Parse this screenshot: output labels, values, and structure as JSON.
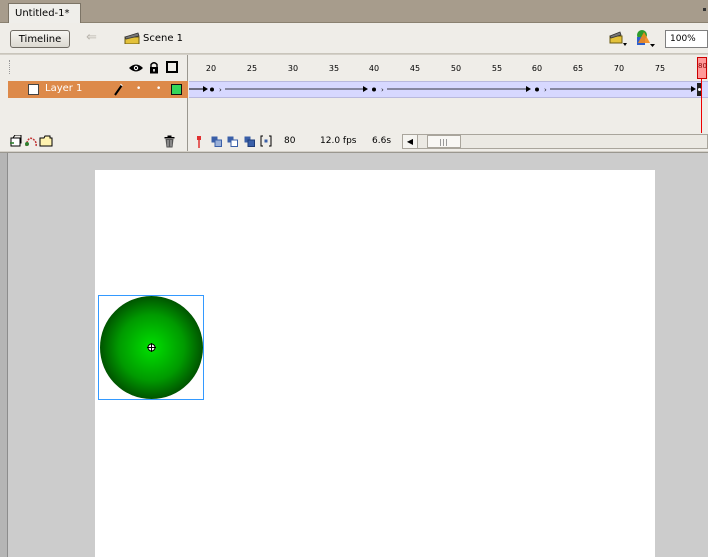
{
  "document": {
    "tab_title": "Untitled-1*"
  },
  "toolbar": {
    "timeline_label": "Timeline",
    "scene_label": "Scene 1",
    "zoom_value": "100%"
  },
  "timeline": {
    "layer_name": "Layer 1",
    "ruler_ticks": [
      "20",
      "25",
      "30",
      "35",
      "40",
      "45",
      "50",
      "55",
      "60",
      "65",
      "70",
      "75"
    ],
    "playhead_frame": "80",
    "current_frame": "80",
    "frame_rate": "12.0 fps",
    "elapsed_time": "6.6s"
  },
  "colors": {
    "layer_highlight": "#dd8a4a",
    "layer_outline_color": "#33d65a",
    "tween_span": "#d7d8ff",
    "playhead": "#ff0000",
    "selection_box": "#3399ff",
    "fill_center": "#00e000",
    "fill_edge": "#001800"
  },
  "icons": {
    "eye": "eye-icon",
    "lock": "lock-icon",
    "outline": "outline-icon",
    "pencil": "pencil-icon",
    "trash": "trash-icon",
    "scene": "clapper-icon",
    "edit_symbols": "edit-symbols-icon"
  }
}
